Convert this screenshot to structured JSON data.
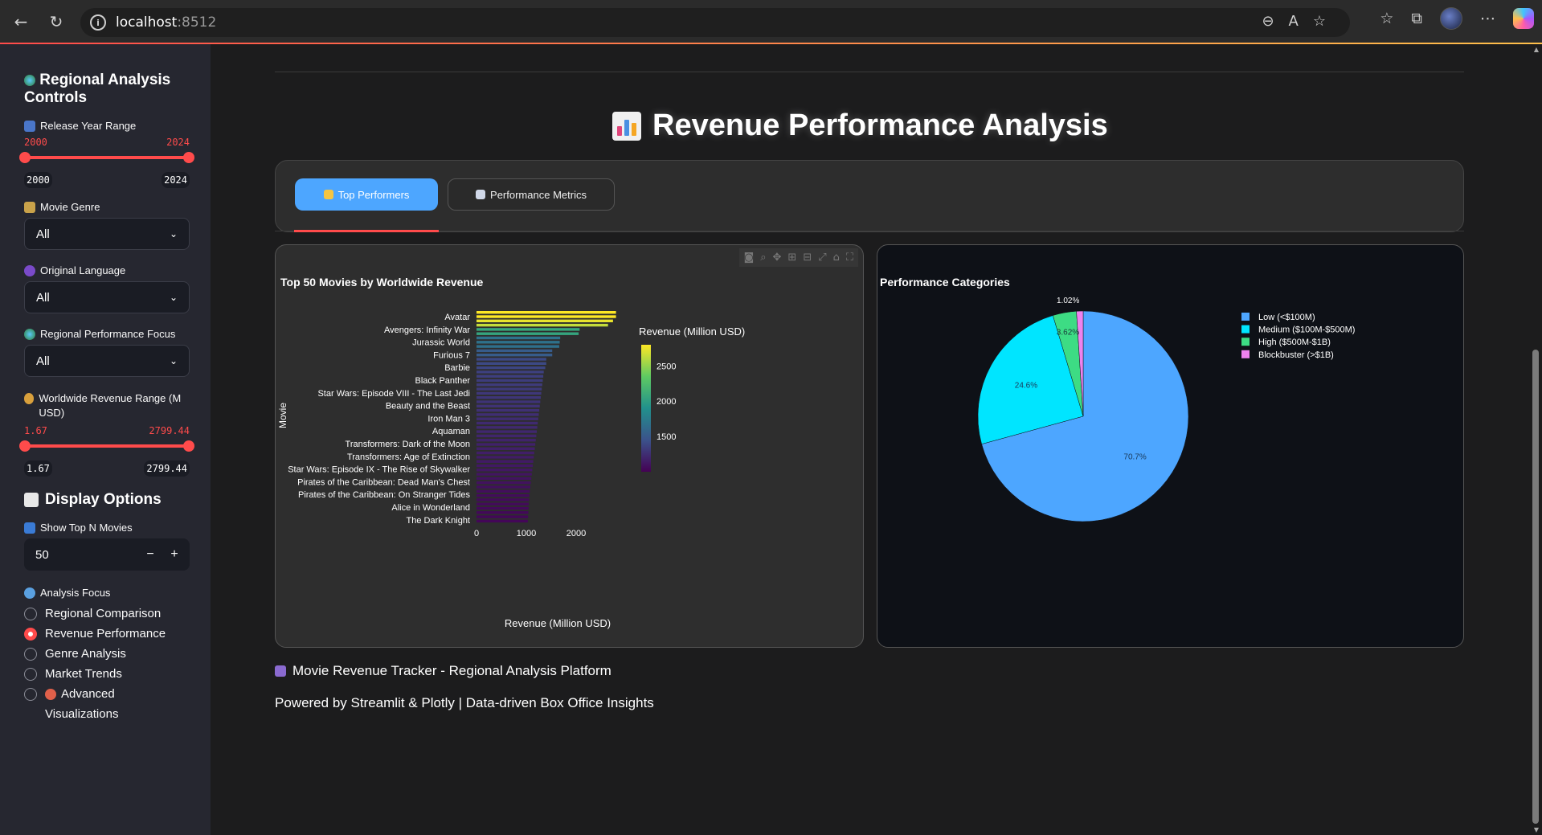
{
  "browser": {
    "url_host": "localhost",
    "url_port": ":8512"
  },
  "sidebar": {
    "title": "Regional Analysis Controls",
    "release_year": {
      "label": "Release Year Range",
      "min": "2000",
      "max": "2024",
      "low": "2000",
      "high": "2024"
    },
    "genre": {
      "label": "Movie Genre",
      "value": "All"
    },
    "language": {
      "label": "Original Language",
      "value": "All"
    },
    "region_focus": {
      "label": "Regional Performance Focus",
      "value": "All"
    },
    "revenue_range": {
      "label": "Worldwide Revenue Range (M USD)",
      "min": "1.67",
      "max": "2799.44",
      "low": "1.67",
      "high": "2799.44"
    },
    "display_options": "Display Options",
    "top_n": {
      "label": "Show Top N Movies",
      "value": "50",
      "minus": "−",
      "plus": "+"
    },
    "analysis_focus": {
      "label": "Analysis Focus",
      "options": [
        "Regional Comparison",
        "Revenue Performance",
        "Genre Analysis",
        "Market Trends",
        "Advanced Visualizations"
      ],
      "selected": "Revenue Performance"
    }
  },
  "main": {
    "page_title": "Revenue Performance Analysis",
    "tabs": [
      {
        "label": "Top Performers",
        "active": true
      },
      {
        "label": "Performance Metrics",
        "active": false
      }
    ],
    "footer_title": "Movie Revenue Tracker - Regional Analysis Platform",
    "footer_sub": "Powered by Streamlit & Plotly | Data-driven Box Office Insights"
  },
  "chart_data": [
    {
      "type": "bar",
      "orientation": "horizontal",
      "title": "Top 50 Movies by Worldwide Revenue",
      "xlabel": "Revenue (Million USD)",
      "ylabel": "Movie",
      "xlim": [
        0,
        2800
      ],
      "xticks": [
        "0",
        "1000",
        "2000"
      ],
      "colorscale": "viridis",
      "colorbar_title": "Revenue (Million USD)",
      "colorbar_ticks": [
        "2500",
        "2000",
        "1500"
      ],
      "colorbar_range": [
        1000,
        2800
      ],
      "labeled_categories": [
        "Avatar",
        "Avengers: Infinity War",
        "Jurassic World",
        "Furious 7",
        "Barbie",
        "Black Panther",
        "Star Wars: Episode VIII - The Last Jedi",
        "Beauty and the Beast",
        "Iron Man 3",
        "Aquaman",
        "Transformers: Dark of the Moon",
        "Transformers: Age of Extinction",
        "Star Wars: Episode IX - The Rise of Skywalker",
        "Pirates of the Caribbean: Dead Man's Chest",
        "Pirates of the Caribbean: On Stranger Tides",
        "Alice in Wonderland",
        "The Dark Knight"
      ],
      "values": [
        2800,
        2800,
        2740,
        2640,
        2070,
        2050,
        1680,
        1670,
        1660,
        1520,
        1520,
        1400,
        1400,
        1380,
        1350,
        1340,
        1330,
        1320,
        1310,
        1300,
        1290,
        1280,
        1270,
        1260,
        1250,
        1240,
        1230,
        1220,
        1210,
        1200,
        1190,
        1180,
        1170,
        1160,
        1150,
        1140,
        1130,
        1120,
        1110,
        1100,
        1090,
        1080,
        1070,
        1060,
        1055,
        1050,
        1045,
        1040,
        1035,
        1030
      ]
    },
    {
      "type": "pie",
      "title": "Performance Categories",
      "labels": [
        "Low (<$100M)",
        "Medium ($100M-$500M)",
        "High ($500M-$1B)",
        "Blockbuster (>$1B)"
      ],
      "values": [
        70.7,
        24.6,
        3.62,
        1.02
      ],
      "value_labels": [
        "70.7%",
        "24.6%",
        "3.62%",
        "1.02%"
      ],
      "colors": [
        "#4da6ff",
        "#00e5ff",
        "#3ddc84",
        "#ee82ee"
      ],
      "legend_position": "top-right"
    }
  ]
}
